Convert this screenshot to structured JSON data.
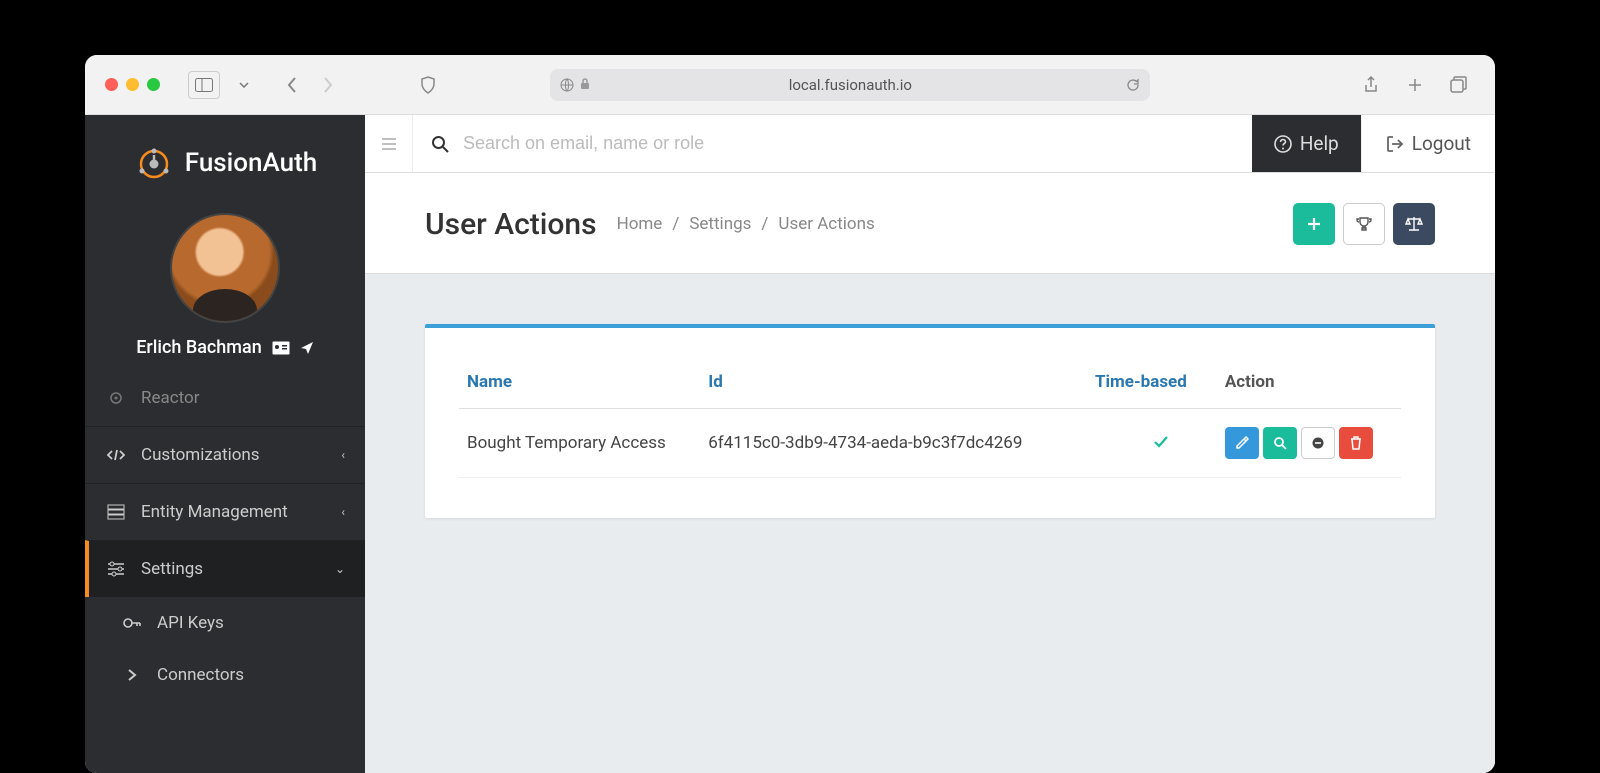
{
  "browser": {
    "url": "local.fusionauth.io"
  },
  "brand": {
    "name": "FusionAuth"
  },
  "user": {
    "name": "Erlich Bachman"
  },
  "sidebar": {
    "items": [
      {
        "label": "Reactor"
      },
      {
        "label": "Customizations"
      },
      {
        "label": "Entity Management"
      },
      {
        "label": "Settings"
      }
    ],
    "subitems": [
      {
        "label": "API Keys"
      },
      {
        "label": "Connectors"
      }
    ]
  },
  "topbar": {
    "search_placeholder": "Search on email, name or role",
    "help_label": "Help",
    "logout_label": "Logout"
  },
  "page": {
    "title": "User Actions",
    "breadcrumb": [
      "Home",
      "Settings",
      "User Actions"
    ]
  },
  "table": {
    "headers": {
      "name": "Name",
      "id": "Id",
      "time_based": "Time-based",
      "action": "Action"
    },
    "rows": [
      {
        "name": "Bought Temporary Access",
        "id": "6f4115c0-3db9-4734-aeda-b9c3f7dc4269",
        "time_based": true
      }
    ]
  }
}
